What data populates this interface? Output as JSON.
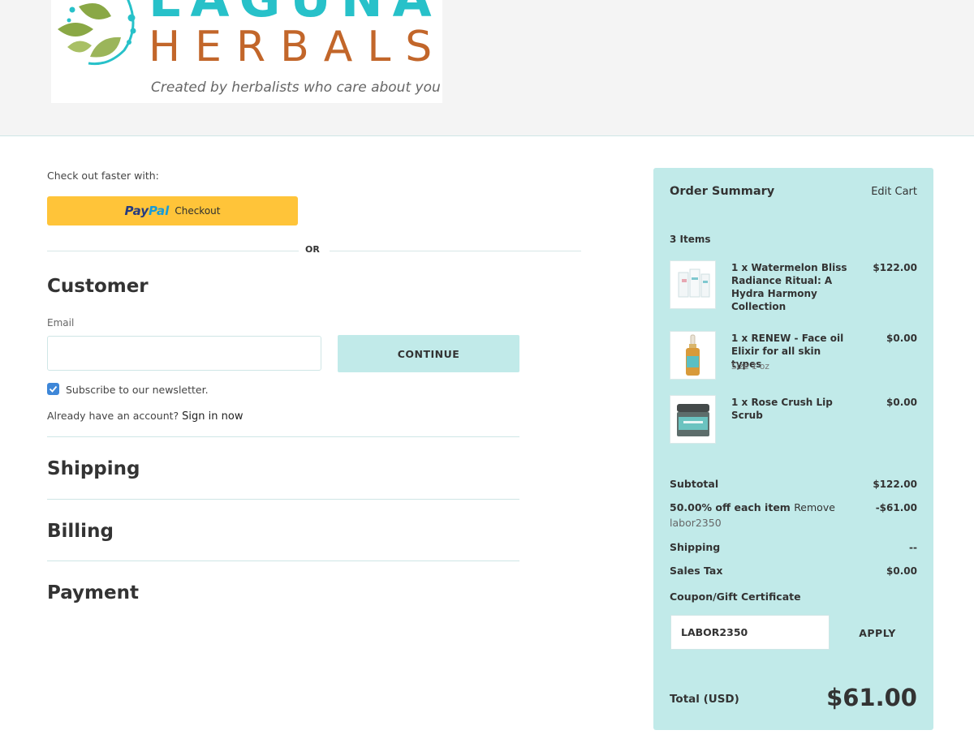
{
  "brand": {
    "name_top": "LAGUNA",
    "name_bottom": "HERBALS",
    "tagline": "Created by herbalists who care about you",
    "colors": {
      "teal": "#27c1c9",
      "orange": "#c2662a",
      "leaf": "#8aa845"
    }
  },
  "checkout": {
    "fast_label": "Check out faster with:",
    "paypal": {
      "pay": "Pay",
      "pal": "Pal",
      "label": "Checkout"
    },
    "or_label": "OR",
    "customer": {
      "heading": "Customer",
      "email_label": "Email",
      "email_value": "",
      "continue_label": "CONTINUE",
      "subscribe_label": "Subscribe to our newsletter.",
      "subscribe_checked": true,
      "account_prompt": "Already have an account?",
      "sign_in_label": "Sign in now"
    },
    "sections": {
      "shipping": "Shipping",
      "billing": "Billing",
      "payment": "Payment"
    }
  },
  "summary": {
    "title": "Order Summary",
    "edit_cart": "Edit Cart",
    "item_count": "3 Items",
    "items": [
      {
        "name": "1 x Watermelon Bliss Radiance Ritual: A Hydra Harmony Collection",
        "option": "",
        "price": "$122.00",
        "icon": "product-set-image"
      },
      {
        "name": "1 x RENEW - Face oil Elixir for all skin types",
        "option": "Size 1 oz",
        "price": "$0.00",
        "icon": "dropper-bottle-image"
      },
      {
        "name": "1 x Rose Crush Lip Scrub",
        "option": "",
        "price": "$0.00",
        "icon": "scrub-jar-image"
      }
    ],
    "subtotal_label": "Subtotal",
    "subtotal": "$122.00",
    "discount_label": "50.00% off each item",
    "discount_remove": "Remove",
    "discount_code": "labor2350",
    "discount_value": "-$61.00",
    "shipping_label": "Shipping",
    "shipping_value": "--",
    "tax_label": "Sales Tax",
    "tax_value": "$0.00",
    "coupon_label": "Coupon/Gift Certificate",
    "coupon_value": "LABOR2350",
    "apply_label": "APPLY",
    "total_label": "Total (USD)",
    "total_value": "$61.00",
    "panel_color": "#c1eae9"
  }
}
